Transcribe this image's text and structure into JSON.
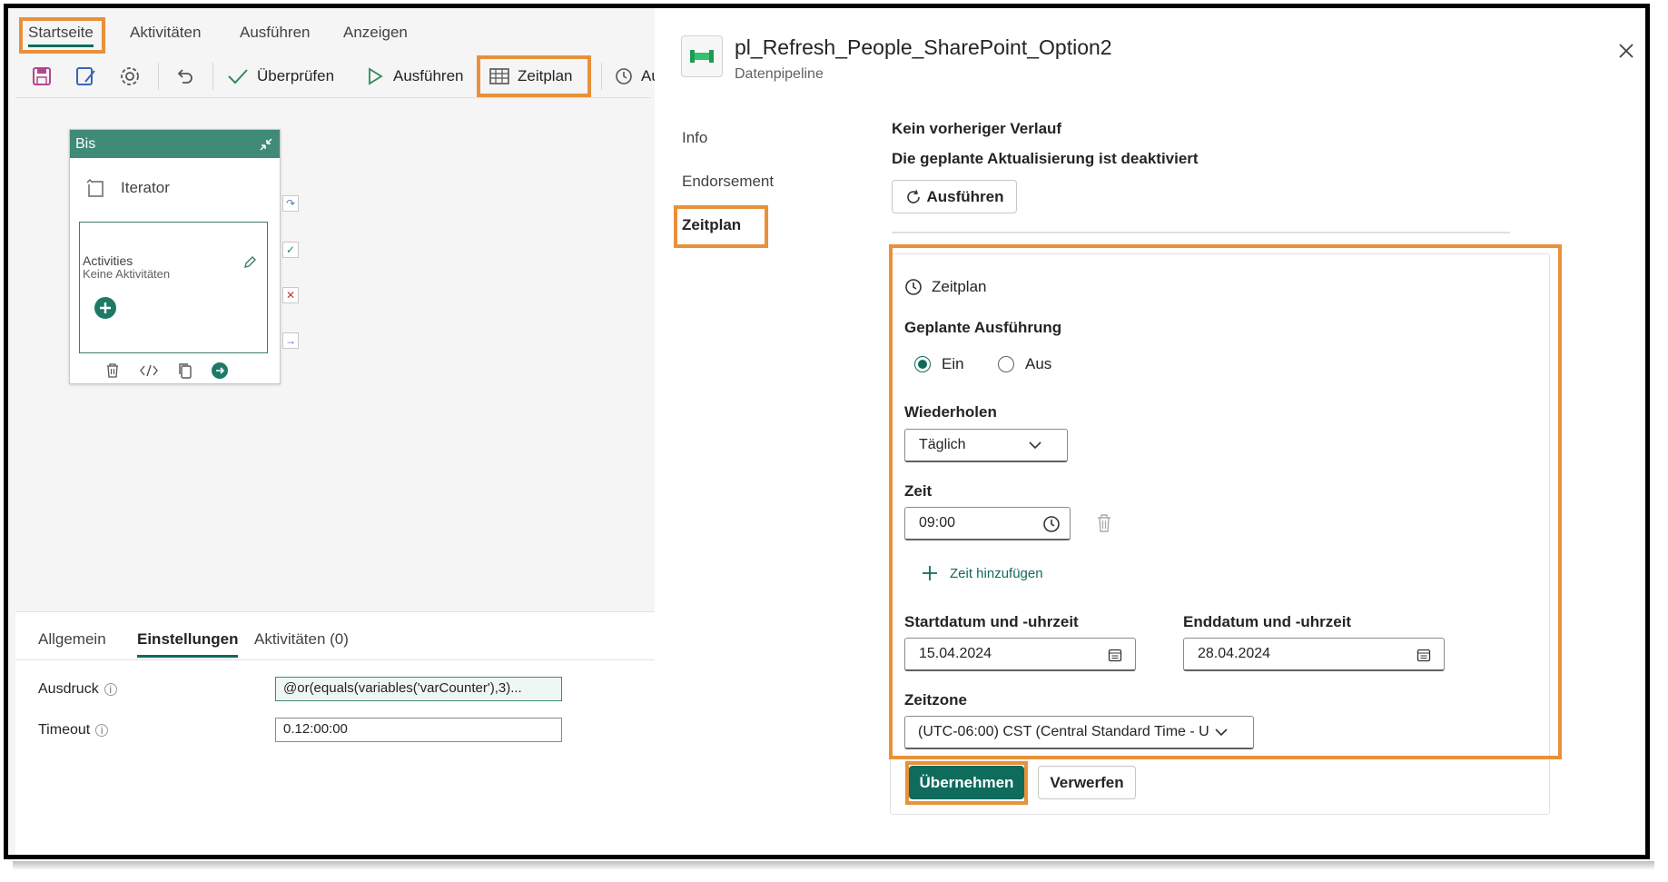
{
  "menu": {
    "home": "Startseite",
    "activities": "Aktivitäten",
    "run": "Ausführen",
    "view": "Anzeigen"
  },
  "toolbar": {
    "validate": "Überprüfen",
    "run": "Ausführen",
    "schedule": "Zeitplan",
    "history_partial": "Au"
  },
  "node": {
    "title": "Bis",
    "iterator_label": "Iterator",
    "activities_label": "Activities",
    "no_activities": "Keine Aktivitäten"
  },
  "bottom_tabs": [
    "Allgemein",
    "Einstellungen",
    "Aktivitäten (0)"
  ],
  "settings": {
    "expression_label": "Ausdruck",
    "expression_value": "@or(equals(variables('varCounter'),3)...",
    "timeout_label": "Timeout",
    "timeout_value": "0.12:00:00"
  },
  "panel": {
    "title": "pl_Refresh_People_SharePoint_Option2",
    "subtitle": "Datenpipeline",
    "nav": [
      "Info",
      "Endorsement",
      "Zeitplan"
    ],
    "no_history": "Kein vorheriger Verlauf",
    "refresh_disabled": "Die geplante Aktualisierung ist deaktiviert",
    "run_button": "Ausführen"
  },
  "schedule": {
    "section_title": "Zeitplan",
    "planned_run_label": "Geplante Ausführung",
    "on_label": "Ein",
    "off_label": "Aus",
    "selected": "Ein",
    "repeat_label": "Wiederholen",
    "repeat_value": "Täglich",
    "time_label": "Zeit",
    "time_value": "09:00",
    "add_time": "Zeit hinzufügen",
    "start_label": "Startdatum und -uhrzeit",
    "start_value": "15.04.2024",
    "end_label": "Enddatum und -uhrzeit",
    "end_value": "28.04.2024",
    "timezone_label": "Zeitzone",
    "timezone_value": "(UTC-06:00) CST (Central Standard Time - U",
    "apply_button": "Übernehmen",
    "discard_button": "Verwerfen"
  },
  "colors": {
    "accent": "#0f6b5b",
    "highlight": "#e8913a",
    "node_header": "#3f8a78"
  }
}
